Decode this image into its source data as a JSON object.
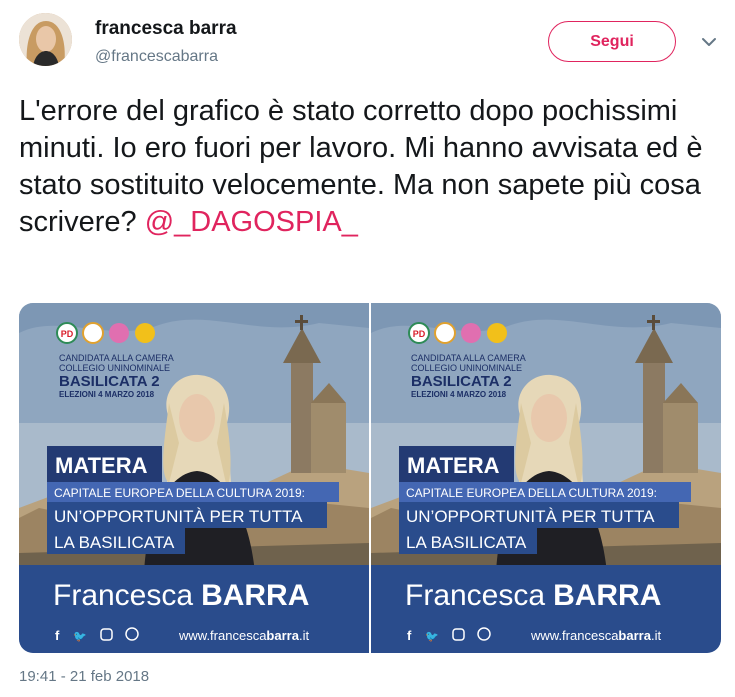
{
  "author": {
    "name": "francesca barra",
    "handle": "@francescabarra"
  },
  "follow_label": "Segui",
  "tweet": {
    "text_before": "L'errore del grafico è stato corretto dopo pochissimi minuti. Io ero fuori per lavoro. Mi hanno avvisata ed è stato sostituito velocemente. Ma non sapete più cosa scrivere? ",
    "mention": "@_DAGOSPIA_"
  },
  "poster": {
    "logos": [
      "PD",
      "Insieme",
      "+Europa",
      "Civica"
    ],
    "candidata_line1": "CANDIDATA ALLA CAMERA",
    "candidata_line2": "COLLEGIO UNINOMINALE",
    "district": "BASILICATA 2",
    "elections": "ELEZIONI 4 MARZO 2018",
    "city": "MATERA",
    "subtitle": "CAPITALE EUROPEA DELLA CULTURA 2019:",
    "slogan_line1": "UN’OPPORTUNITÀ PER TUTTA",
    "slogan_line2": "LA BASILICATA",
    "first_name": "Francesca",
    "last_name": "BARRA",
    "website_prefix": "www.francesca",
    "website_bold": "barra",
    "website_suffix": ".it"
  },
  "timestamp": "19:41 - 21 feb 2018",
  "colors": {
    "accent": "#e0245e",
    "poster_blue": "#2a4c8c",
    "poster_dark_blue": "#233a73"
  }
}
